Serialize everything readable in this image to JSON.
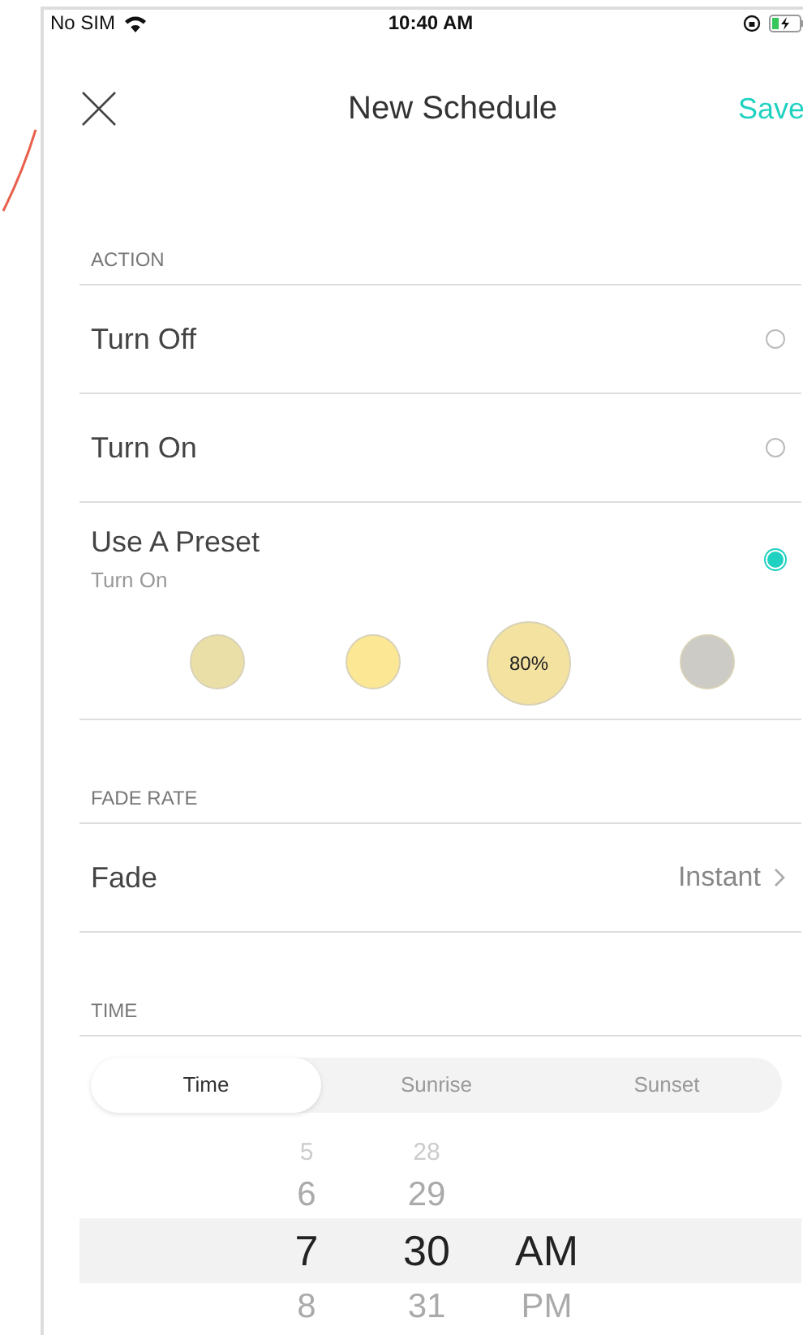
{
  "status_bar": {
    "carrier": "No SIM",
    "time": "10:40 AM"
  },
  "nav": {
    "title": "New Schedule",
    "save": "Save"
  },
  "action": {
    "header": "ACTION",
    "options": [
      {
        "label": "Turn Off",
        "selected": false
      },
      {
        "label": "Turn On",
        "selected": false
      },
      {
        "label": "Use A Preset",
        "sublabel": "Turn On",
        "selected": true
      }
    ],
    "presets": [
      {
        "color": "#ebdfa8",
        "selected": false
      },
      {
        "color": "#fce794",
        "selected": false
      },
      {
        "color": "#f3e2a0",
        "selected": true,
        "label": "80%"
      },
      {
        "color": "#cccbc5",
        "selected": false
      }
    ]
  },
  "fade": {
    "header": "FADE RATE",
    "label": "Fade",
    "value": "Instant"
  },
  "time": {
    "header": "TIME",
    "segments": [
      {
        "label": "Time",
        "selected": true
      },
      {
        "label": "Sunrise",
        "selected": false
      },
      {
        "label": "Sunset",
        "selected": false
      }
    ],
    "picker": [
      {
        "items": [
          {
            "text": "5",
            "selected": false
          },
          {
            "text": "6",
            "selected": false
          },
          {
            "text": "7",
            "selected": true
          },
          {
            "text": "8",
            "selected": false
          }
        ]
      },
      {
        "items": [
          {
            "text": "28",
            "selected": false
          },
          {
            "text": "29",
            "selected": false
          },
          {
            "text": "30",
            "selected": true
          },
          {
            "text": "31",
            "selected": false
          }
        ]
      },
      {
        "items": [
          {
            "text": "AM",
            "selected": true
          },
          {
            "text": "PM",
            "selected": false
          }
        ]
      }
    ]
  }
}
